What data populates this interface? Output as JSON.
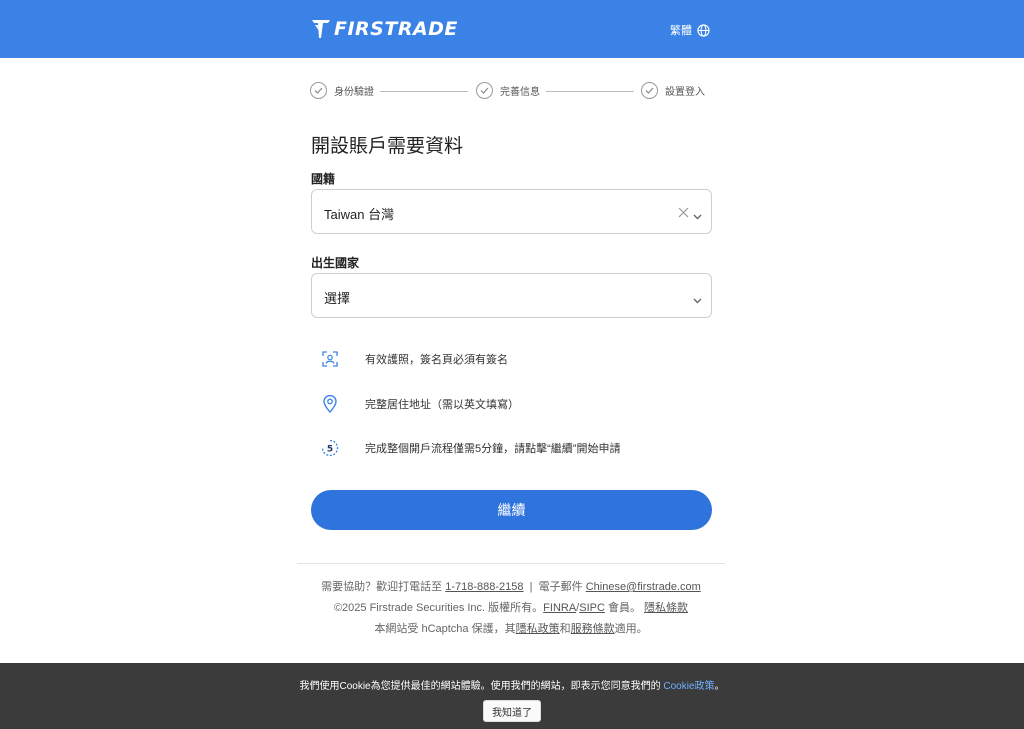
{
  "header": {
    "logo_text": "FIRSTRADE",
    "lang_label": "繁體",
    "bg_color": "#3a82e6"
  },
  "steps": [
    {
      "label": "身份驗證",
      "icon": "check-circle-icon"
    },
    {
      "label": "完善信息",
      "icon": "check-circle-icon"
    },
    {
      "label": "設置登入",
      "icon": "check-circle-icon"
    }
  ],
  "form": {
    "title": "開設賬戶需要資料",
    "nationality": {
      "label": "國籍",
      "value": "Taiwan 台灣"
    },
    "birth_country": {
      "label": "出生國家",
      "value": "選擇"
    }
  },
  "requirements": [
    {
      "icon": "id-scan-icon",
      "text": "有效護照，簽名頁必須有簽名"
    },
    {
      "icon": "location-pin-icon",
      "text": "完整居住地址（需以英文填寫）"
    },
    {
      "icon": "timer-5-icon",
      "text": "完成整個開戶流程僅需5分鐘，請點擊“繼續”開始申請"
    }
  ],
  "continue_button": {
    "label": "繼續",
    "color": "#2f73dd"
  },
  "footer": {
    "help_prefix": "需要協助？歡迎打電話至",
    "phone": "1-718-888-2158",
    "sep": "|",
    "email_prefix": "電子郵件",
    "email": "Chinese@firstrade.com",
    "copyright_prefix": "©2025 Firstrade Securities Inc. 版權所有。",
    "finra": "FINRA",
    "slash": "/",
    "sipc": "SIPC",
    "member": "會員。",
    "privacy": "隱私條款",
    "hcaptcha_prefix": "本網站受 hCaptcha 保護，其",
    "hcaptcha_privacy": "隱私政策",
    "and": "和",
    "terms": "服務條款",
    "applies": "適用。"
  },
  "cookie_banner": {
    "text": "我們使用Cookie為您提供最佳的網站體驗。使用我們的網站，即表示您同意我們的",
    "link": "Cookie政策",
    "end": "。",
    "button": "我知道了"
  }
}
